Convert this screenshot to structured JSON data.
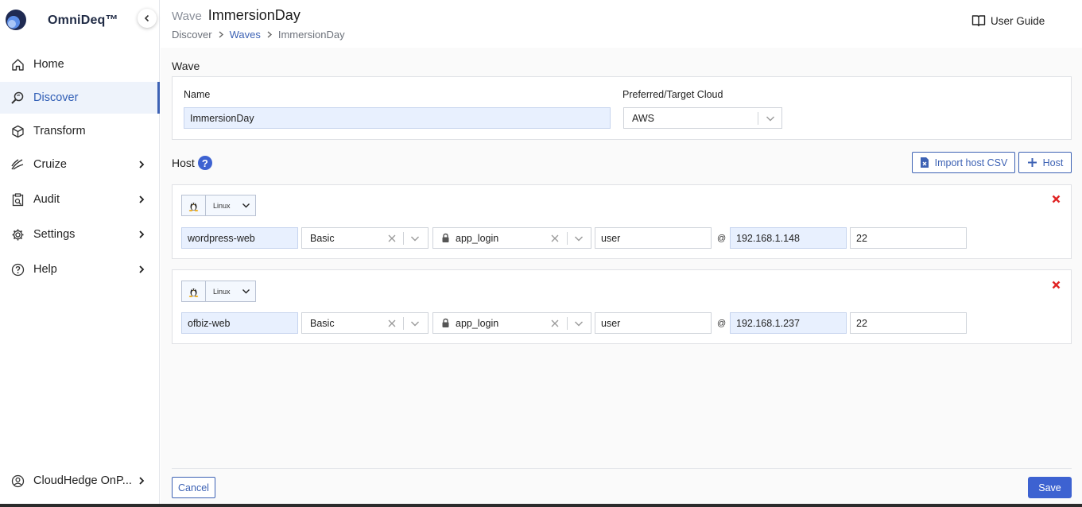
{
  "app": {
    "name": "OmniDeq™"
  },
  "sidebar": {
    "items": [
      {
        "label": "Home",
        "icon": "home-icon"
      },
      {
        "label": "Discover",
        "icon": "discover-icon"
      },
      {
        "label": "Transform",
        "icon": "cube-icon"
      },
      {
        "label": "Cruize",
        "icon": "cruize-icon"
      },
      {
        "label": "Audit",
        "icon": "clipboard-icon"
      },
      {
        "label": "Settings",
        "icon": "gear-icon"
      },
      {
        "label": "Help",
        "icon": "question-circle-icon"
      }
    ],
    "account": {
      "label": "CloudHedge OnP..."
    }
  },
  "header": {
    "prefix": "Wave",
    "title": "ImmersionDay",
    "breadcrumb": [
      "Discover",
      "Waves",
      "ImmersionDay"
    ],
    "user_guide": "User Guide"
  },
  "wave": {
    "section_label": "Wave",
    "name_label": "Name",
    "name_value": "ImmersionDay",
    "cloud_label": "Preferred/Target Cloud",
    "cloud_value": "AWS"
  },
  "host": {
    "section_label": "Host",
    "import_label": "Import host CSV",
    "add_label": "Host",
    "rows": [
      {
        "os": "Linux",
        "hostname": "wordpress-web",
        "auth": "Basic",
        "credential": "app_login",
        "user": "user",
        "ip": "192.168.1.148",
        "port": "22"
      },
      {
        "os": "Linux",
        "hostname": "ofbiz-web",
        "auth": "Basic",
        "credential": "app_login",
        "user": "user",
        "ip": "192.168.1.237",
        "port": "22"
      }
    ]
  },
  "footer": {
    "cancel": "Cancel",
    "save": "Save"
  },
  "colors": {
    "accent": "#3d62d1",
    "delete": "#e02424",
    "filled_input": "#e8f0fe"
  }
}
